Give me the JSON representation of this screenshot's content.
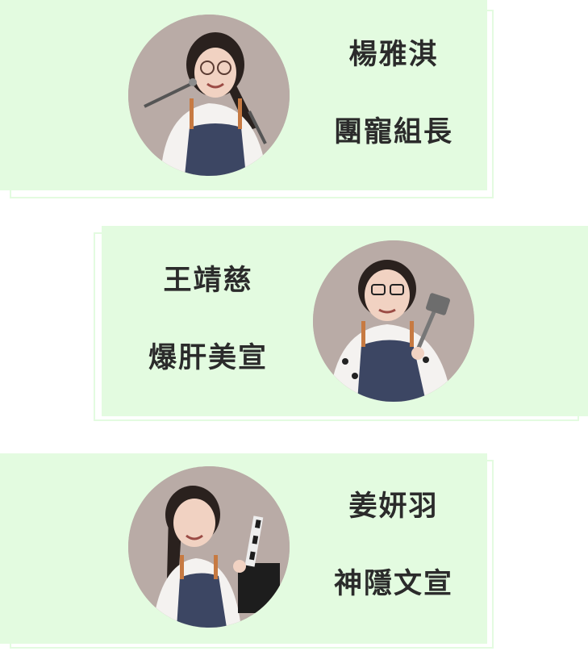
{
  "members": [
    {
      "name": "楊雅淇",
      "role": "團寵組長",
      "photo_alt": "member-photo-1"
    },
    {
      "name": "王靖慈",
      "role": "爆肝美宣",
      "photo_alt": "member-photo-2"
    },
    {
      "name": "姜妍羽",
      "role": "神隱文宣",
      "photo_alt": "member-photo-3"
    }
  ],
  "colors": {
    "card_bg": "#e3fbe0",
    "text": "#2b2b2b",
    "photo_bg": "#b9aba6",
    "apron": "#3c4663",
    "shirt": "#f4f2f0",
    "hair": "#2a211e",
    "skin": "#f1d2c2",
    "strap": "#c77a42"
  }
}
